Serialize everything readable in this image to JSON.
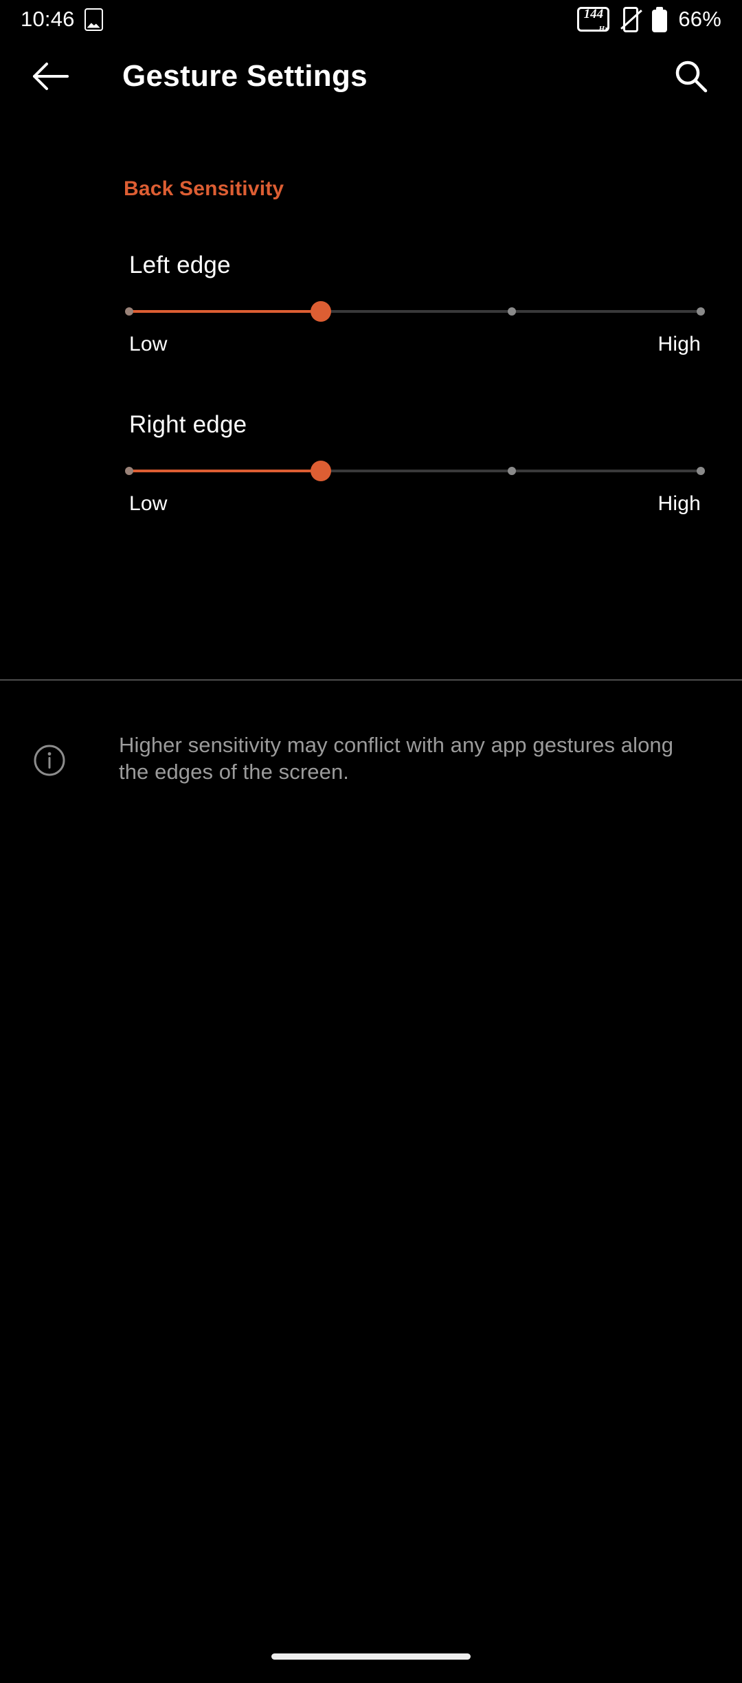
{
  "theme": {
    "background": "#000000",
    "accent": "#dd5e33",
    "primary_text": "#ffffff",
    "secondary_text": "#9b9b9b",
    "track_inactive": "#39393a",
    "divider": "#4d4d4d"
  },
  "status_bar": {
    "clock": "10:46",
    "screenshot_icon": "screenshot-icon",
    "refresh_rate_value": "144",
    "refresh_rate_unit": "Hz",
    "vibrate_icon": "vibrate-off-icon",
    "battery_icon": "battery-icon",
    "battery_percent": "66%"
  },
  "toolbar": {
    "back_icon": "back-arrow-icon",
    "title": "Gesture Settings",
    "search_icon": "search-icon"
  },
  "main": {
    "section_header": "Back Sensitivity",
    "sliders": [
      {
        "label": "Left edge",
        "low_label": "Low",
        "high_label": "High",
        "value": 1,
        "min": 0,
        "max": 3,
        "tick_count": 4,
        "percent": 33.5
      },
      {
        "label": "Right edge",
        "low_label": "Low",
        "high_label": "High",
        "value": 1,
        "min": 0,
        "max": 3,
        "tick_count": 4,
        "percent": 33.5
      }
    ],
    "info": {
      "icon": "info-circle-icon",
      "text": "Higher sensitivity may conflict with any app gestures along the edges of the screen."
    }
  },
  "navigation": {
    "home_pill": "home-gesture-pill"
  }
}
